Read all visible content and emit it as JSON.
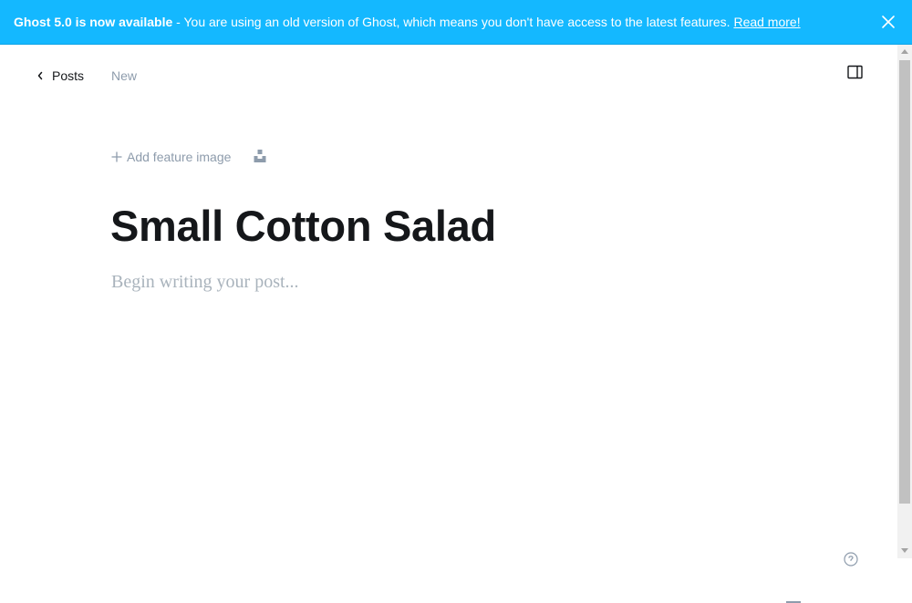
{
  "banner": {
    "heading": "Ghost 5.0 is now available",
    "message": " - You are using an old version of Ghost, which means you don't have access to the latest features. ",
    "link_label": "Read more!",
    "background_color": "#14b8ff",
    "close_icon": "close-icon"
  },
  "nav": {
    "back_label": "Posts",
    "back_icon": "chevron-left-icon",
    "status": "New",
    "settings_icon": "sidebar-toggle-icon"
  },
  "editor": {
    "feature_image_label": "Add feature image",
    "feature_image_icon": "plus-icon",
    "unsplash_icon": "unsplash-icon",
    "title": "Small Cotton Salad",
    "body_placeholder": "Begin writing your post...",
    "help_icon": "help-icon"
  }
}
